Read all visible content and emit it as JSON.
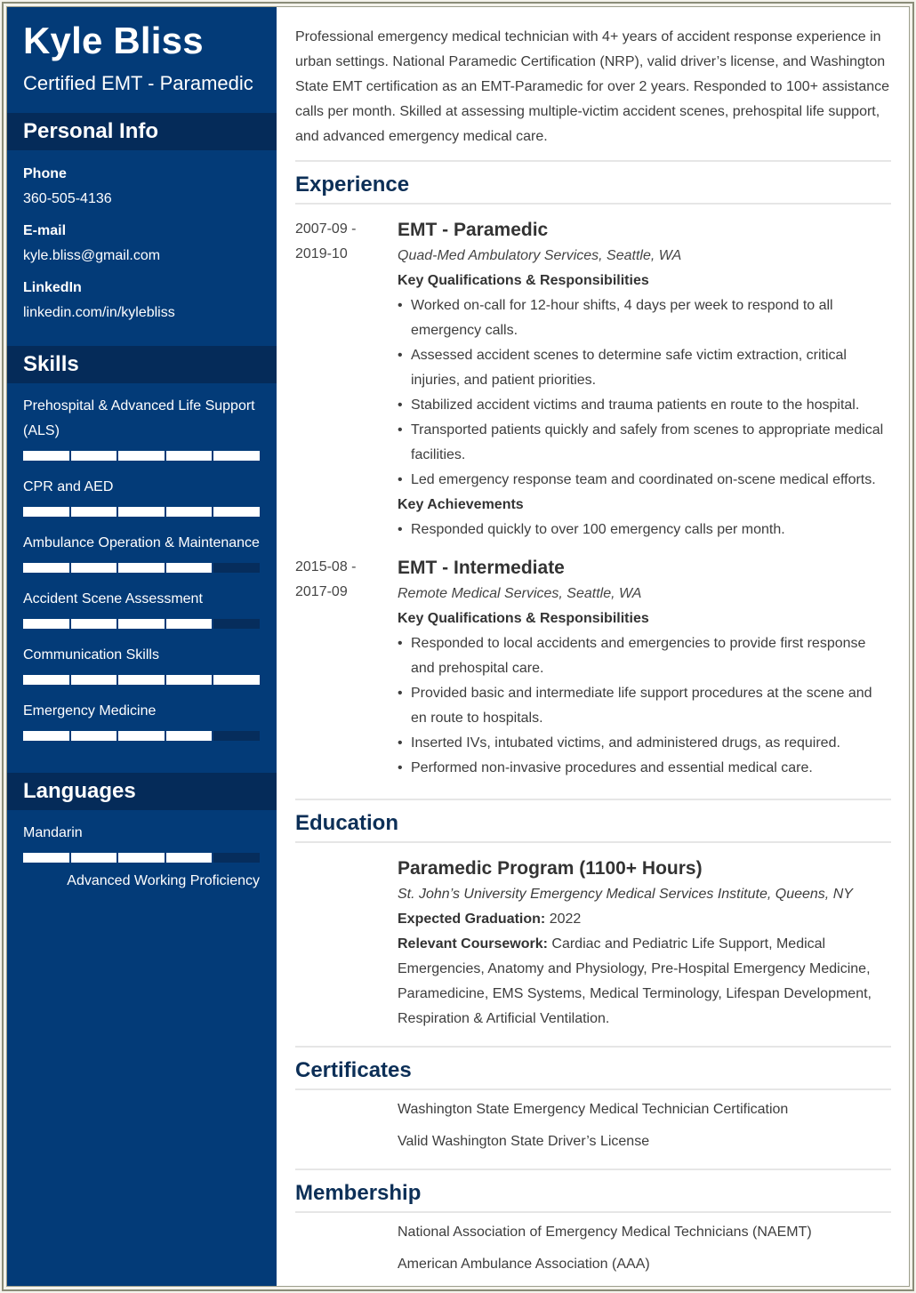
{
  "profile": {
    "name": "Kyle Bliss",
    "title": "Certified EMT - Paramedic"
  },
  "personal_info": {
    "heading": "Personal Info",
    "items": [
      {
        "label": "Phone",
        "value": "360-505-4136"
      },
      {
        "label": "E-mail",
        "value": "kyle.bliss@gmail.com"
      },
      {
        "label": "LinkedIn",
        "value": "linkedin.com/in/kylebliss"
      }
    ]
  },
  "skills": {
    "heading": "Skills",
    "max_level": 5,
    "items": [
      {
        "name": "Prehospital & Advanced Life Support (ALS)",
        "level": 5
      },
      {
        "name": "CPR and AED",
        "level": 5
      },
      {
        "name": "Ambulance Operation & Maintenance",
        "level": 4
      },
      {
        "name": "Accident Scene Assessment",
        "level": 4
      },
      {
        "name": "Communication Skills",
        "level": 5
      },
      {
        "name": "Emergency Medicine",
        "level": 4
      }
    ]
  },
  "languages": {
    "heading": "Languages",
    "items": [
      {
        "name": "Mandarin",
        "level": 4,
        "proficiency": "Advanced Working Proficiency"
      }
    ]
  },
  "summary": "Professional emergency medical technician with 4+ years of accident response experience in urban settings. National Paramedic Certification (NRP), valid driver’s license, and Washington State EMT certification as an EMT-Paramedic for over 2 years. Responded to 100+ assistance calls per month. Skilled at assessing multiple-victim accident scenes, prehospital life support, and advanced emergency medical care.",
  "experience": {
    "heading": "Experience",
    "jobs": [
      {
        "date_start": "2007-09 -",
        "date_end": "2019-10",
        "title": "EMT - Paramedic",
        "company": "Quad-Med Ambulatory Services, Seattle, WA",
        "qual_heading": "Key Qualifications & Responsibilities",
        "responsibilities": [
          "Worked on-call for 12-hour shifts, 4 days per week to respond to all emergency calls.",
          "Assessed accident scenes to determine safe victim extraction, critical injuries, and patient priorities.",
          "Stabilized accident victims and trauma patients en route to the hospital.",
          "Transported patients quickly and safely from scenes to appropriate medical facilities.",
          "Led emergency response team and coordinated on-scene medical efforts."
        ],
        "achievements_heading": "Key Achievements",
        "achievements": [
          "Responded quickly to over 100 emergency calls per month."
        ]
      },
      {
        "date_start": "2015-08 -",
        "date_end": "2017-09",
        "title": "EMT - Intermediate",
        "company": "Remote Medical Services, Seattle, WA",
        "qual_heading": "Key Qualifications & Responsibilities",
        "responsibilities": [
          "Responded to local accidents and emergencies to provide first response and prehospital care.",
          "Provided basic and intermediate life support procedures at the scene and en route to hospitals.",
          "Inserted IVs, intubated victims, and administered drugs, as required.",
          "Performed non-invasive procedures and essential medical care."
        ]
      }
    ]
  },
  "education": {
    "heading": "Education",
    "program": "Paramedic Program (1100+ Hours)",
    "school": "St. John’s University Emergency Medical Services Institute, Queens, NY",
    "graduation_label": "Expected Graduation:",
    "graduation_value": "2022",
    "coursework_label": "Relevant Coursework:",
    "coursework_value": "Cardiac and Pediatric Life Support, Medical Emergencies, Anatomy and Physiology, Pre-Hospital Emergency Medicine, Paramedicine, EMS Systems, Medical Terminology, Lifespan Development, Respiration & Artificial Ventilation."
  },
  "certificates": {
    "heading": "Certificates",
    "items": [
      "Washington State Emergency Medical Technician Certification",
      "Valid Washington State Driver’s License"
    ]
  },
  "membership": {
    "heading": "Membership",
    "items": [
      "National Association of Emergency Medical Technicians (NAEMT)",
      "American Ambulance Association (AAA)"
    ]
  },
  "colors": {
    "sidebar": "#033b78",
    "sidebar_header": "#052b59",
    "heading_text": "#0c2f57"
  }
}
